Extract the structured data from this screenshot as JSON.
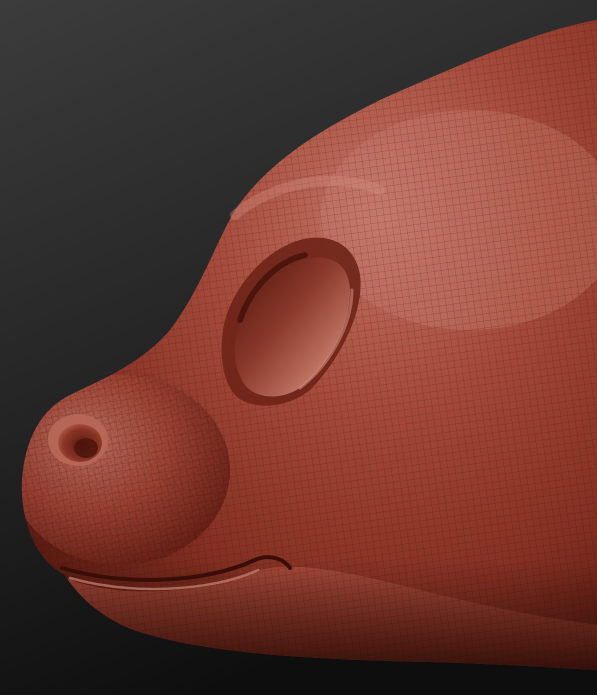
{
  "scene": {
    "subject": "sculpted-creature-head-wireframe",
    "colors": {
      "background_top": "#3a3a3a",
      "background_bottom": "#101010",
      "clay_light": "#c8786a",
      "clay_mid": "#9a3c2c",
      "clay_dark": "#5a1a10",
      "clay_shadow": "#3a0e08",
      "wire": "#2a0a06"
    }
  }
}
